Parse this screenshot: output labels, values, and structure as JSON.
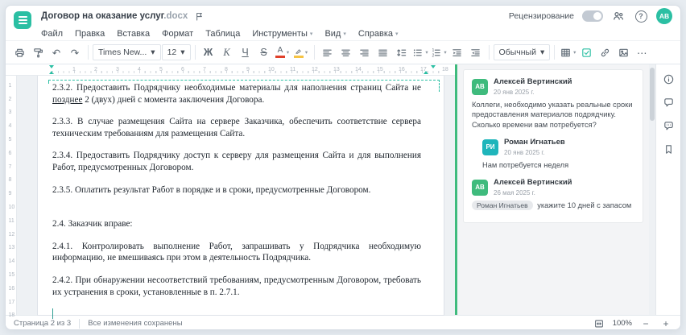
{
  "window": {
    "title": "Договор на оказание услуг",
    "ext": ".docx"
  },
  "topbar": {
    "review_label": "Рецензирование",
    "review_toggle_on": false,
    "avatar": "АВ"
  },
  "menubar": {
    "items": [
      {
        "key": "file",
        "label": "Файл",
        "chevron": false
      },
      {
        "key": "edit",
        "label": "Правка",
        "chevron": false
      },
      {
        "key": "insert",
        "label": "Вставка",
        "chevron": false
      },
      {
        "key": "format",
        "label": "Формат",
        "chevron": false
      },
      {
        "key": "table",
        "label": "Таблица",
        "chevron": false
      },
      {
        "key": "tools",
        "label": "Инструменты",
        "chevron": true
      },
      {
        "key": "view",
        "label": "Вид",
        "chevron": true
      },
      {
        "key": "help",
        "label": "Справка",
        "chevron": true
      }
    ]
  },
  "toolbar": {
    "undo_glyph": "↶",
    "redo_glyph": "↷",
    "font_name": "Times New...",
    "font_size": "12",
    "bold": "Ж",
    "italic": "К",
    "underline": "Ч",
    "strike": "S",
    "font_color_letter": "А",
    "style_name": "Обычный",
    "more": "⋯"
  },
  "ruler": {
    "h": [
      1,
      2,
      3,
      4,
      5,
      6,
      7,
      8,
      9,
      10,
      11,
      12,
      13,
      14,
      15,
      16,
      17,
      18
    ],
    "v": [
      1,
      2,
      3,
      4,
      5,
      6,
      7,
      8,
      9,
      10,
      11,
      12,
      13,
      14,
      15,
      16,
      17,
      18
    ]
  },
  "document": {
    "paragraphs": [
      {
        "anchor": true,
        "segments": [
          {
            "t": "2.3.2. Предоставить Подрядчику необходимые материалы для наполнения страниц Сайта не "
          },
          {
            "t": "позднее",
            "u": true
          },
          {
            "t": " 2 (двух) дней с момента заключения Договора."
          }
        ]
      },
      {
        "segments": [
          {
            "t": "2.3.3. В случае размещения Сайта на сервере Заказчика, обеспечить соответствие сервера техническим требованиям для размещения Сайта."
          }
        ]
      },
      {
        "segments": [
          {
            "t": "2.3.4. Предоставить Подрядчику доступ к серверу для размещения Сайта и для выполнения Работ, предусмотренных Договором."
          }
        ]
      },
      {
        "segments": [
          {
            "t": "2.3.5. Оплатить результат Работ в порядке и в сроки, предусмотренные Договором."
          }
        ]
      },
      {
        "space_before": true,
        "segments": [
          {
            "t": "2.4. Заказчик вправе:"
          }
        ]
      },
      {
        "segments": [
          {
            "t": "2.4.1. Контролировать выполнение Работ, запрашивать у Подрядчика необходимую информацию, не вмешиваясь при этом в деятельность Подрядчика."
          }
        ]
      },
      {
        "segments": [
          {
            "t": "2.4.2. При обнаружении несоответствий требованиям, предусмотренным Договором, требовать их устранения в сроки, установленные в п. 2.7.1."
          }
        ]
      }
    ]
  },
  "comments": {
    "thread": [
      {
        "initials": "АВ",
        "avatar_color": "#3fbb7d",
        "name": "Алексей Вертинский",
        "date": "20 янв 2025 г.",
        "text": "Коллеги, необходимо указать реальные сроки предоставления материалов подрядчику. Сколько времени вам потребуется?"
      },
      {
        "initials": "РИ",
        "avatar_color": "#1fb5bb",
        "name": "Роман Игнатьев",
        "date": "20 янв 2025 г.",
        "text": "Нам потребуется неделя",
        "reply": true
      },
      {
        "initials": "АВ",
        "avatar_color": "#3fbb7d",
        "name": "Алексей Вертинский",
        "date": "26 мая 2025 г.",
        "mention": "Роман Игнатьев",
        "text": "укажите 10 дней с запасом"
      }
    ]
  },
  "statusbar": {
    "page": "Страница 2 из 3",
    "saved": "Все изменения сохранены",
    "zoom": "100%"
  },
  "colors": {
    "teal": "#2bbfa3",
    "green": "#3fbb7d",
    "red": "#e0402a",
    "yellow": "#f6c344"
  }
}
